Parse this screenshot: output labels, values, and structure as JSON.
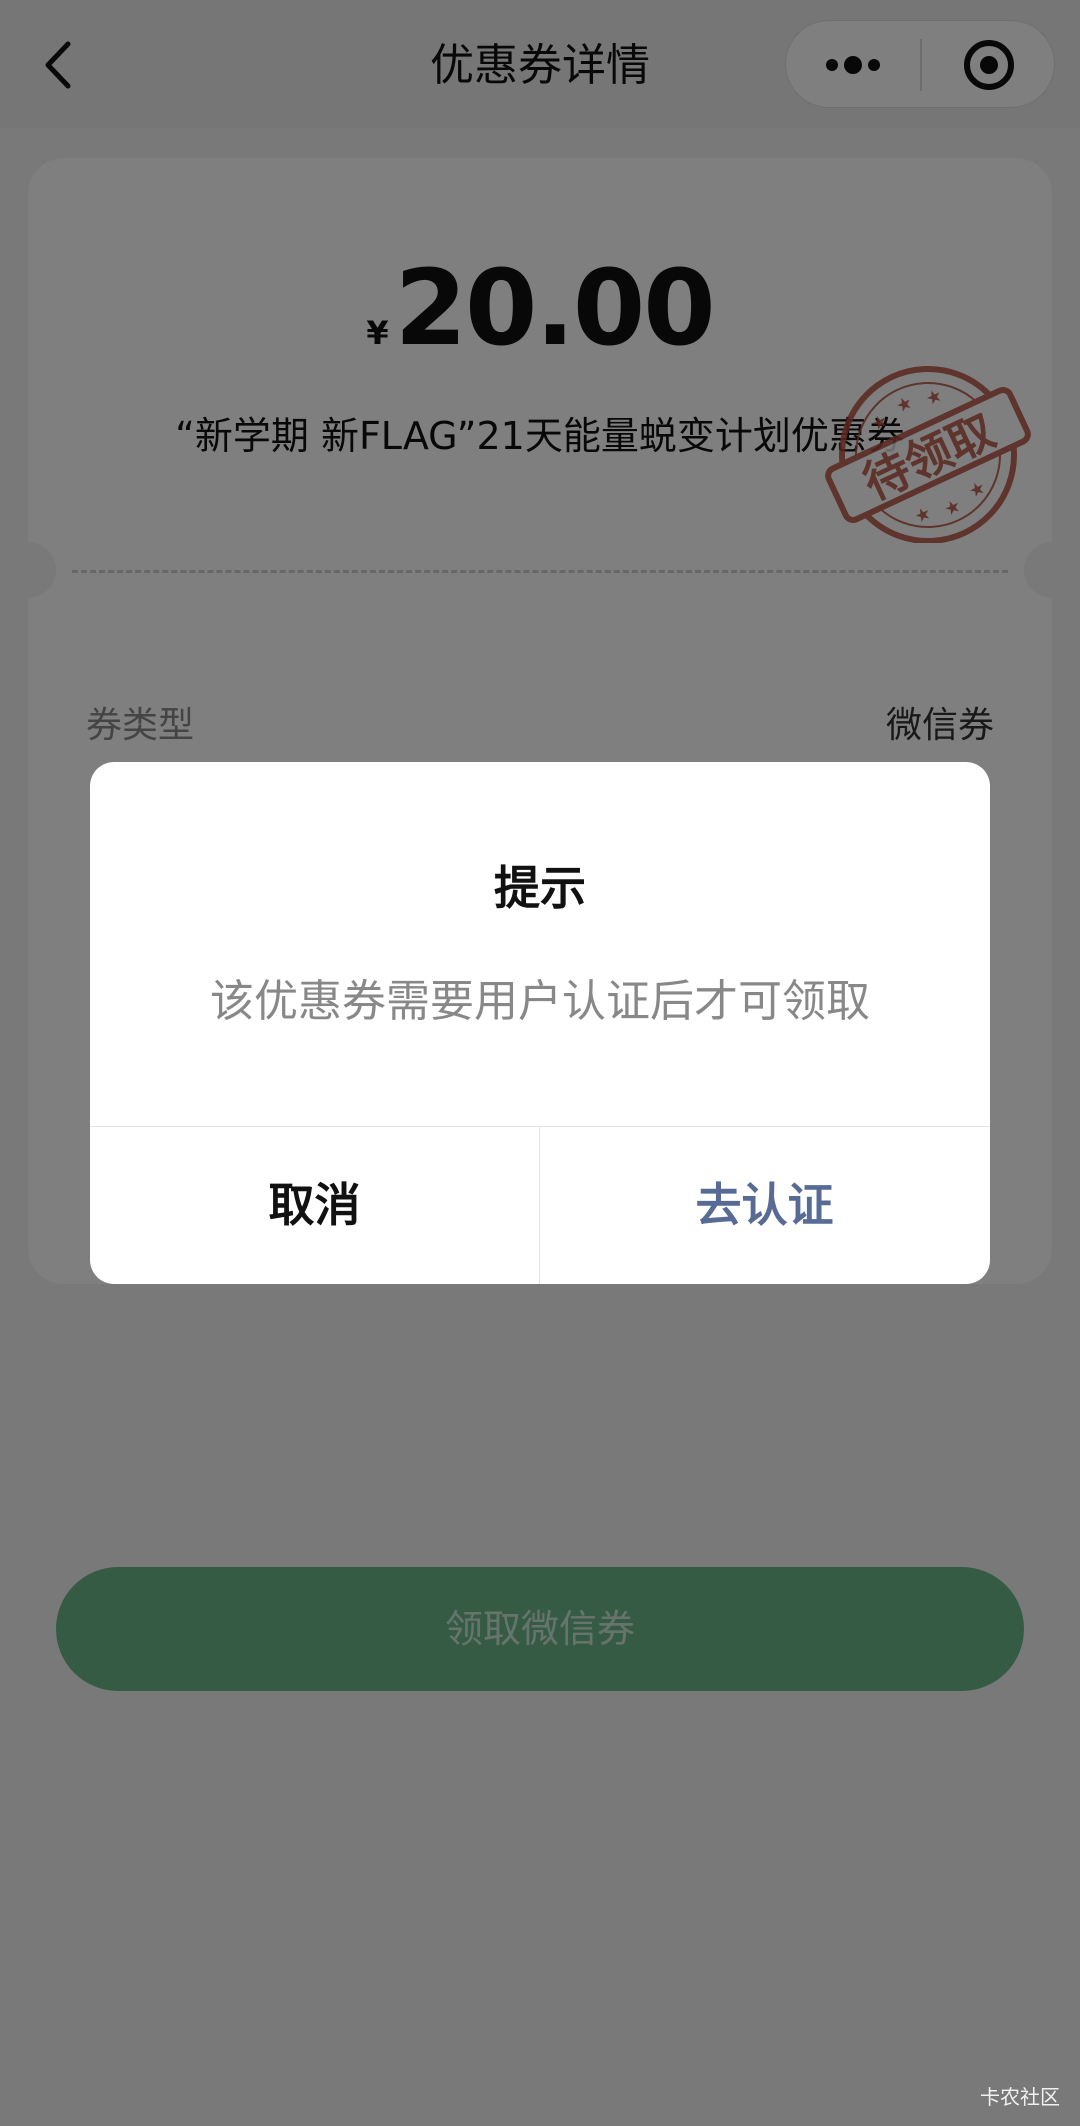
{
  "nav": {
    "title": "优惠券详情",
    "back_icon": "chevron-left-icon",
    "more_icon": "more-dots-icon",
    "close_icon": "target-close-icon"
  },
  "coupon": {
    "currency": "¥",
    "amount": "20.00",
    "name": "“新学期 新FLAG”21天能量蜕变计划优惠券",
    "stamp_text": "待领取",
    "stamp_color": "#b2503f",
    "details": [
      {
        "label": "券类型",
        "value": "微信券"
      }
    ]
  },
  "claim_button": {
    "label": "领取微信券",
    "color": "#6ab78a"
  },
  "dialog": {
    "title": "提示",
    "message": "该优惠券需要用户认证后才可领取",
    "cancel_label": "取消",
    "confirm_label": "去认证",
    "confirm_color": "#576b95"
  },
  "watermark": "卡农社区"
}
